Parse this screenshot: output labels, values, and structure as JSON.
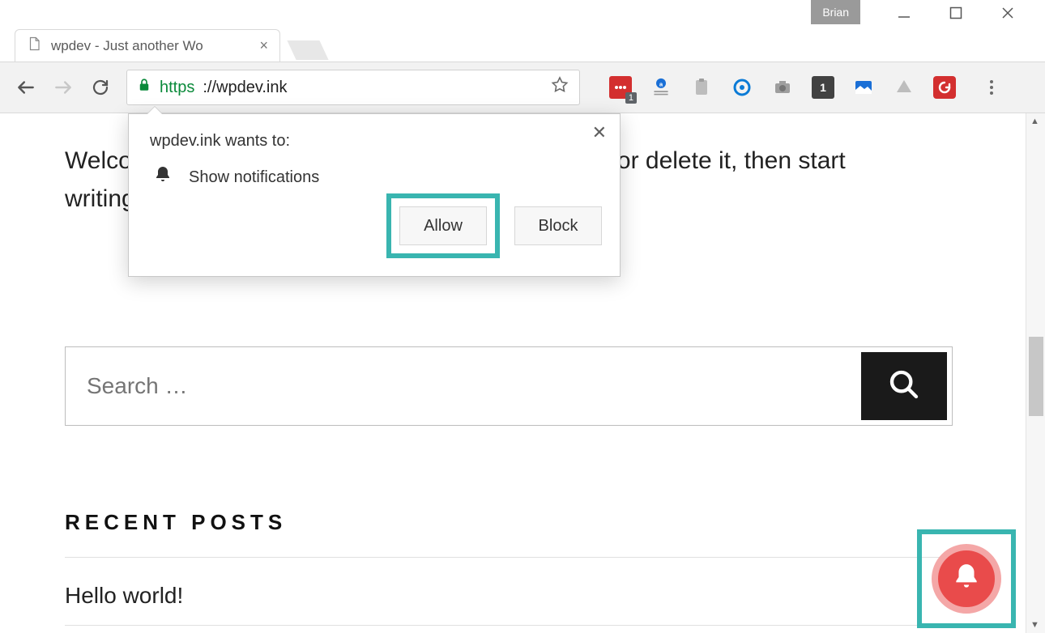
{
  "window": {
    "profile_label": "Brian"
  },
  "tab": {
    "title": "wpdev - Just another Wo"
  },
  "omnibox": {
    "scheme": "https",
    "rest": "://wpdev.ink"
  },
  "extensions": {
    "badge1": "1",
    "badge2": "1"
  },
  "page": {
    "welcome_line1": "Welcome to WordPress. This is your first post. Edit or delete it, then start",
    "welcome_line2": "writing!",
    "search_placeholder": "Search …",
    "recent_heading": "RECENT POSTS",
    "post1": "Hello world!"
  },
  "permission": {
    "header": "wpdev.ink wants to:",
    "item": "Show notifications",
    "allow": "Allow",
    "block": "Block"
  }
}
